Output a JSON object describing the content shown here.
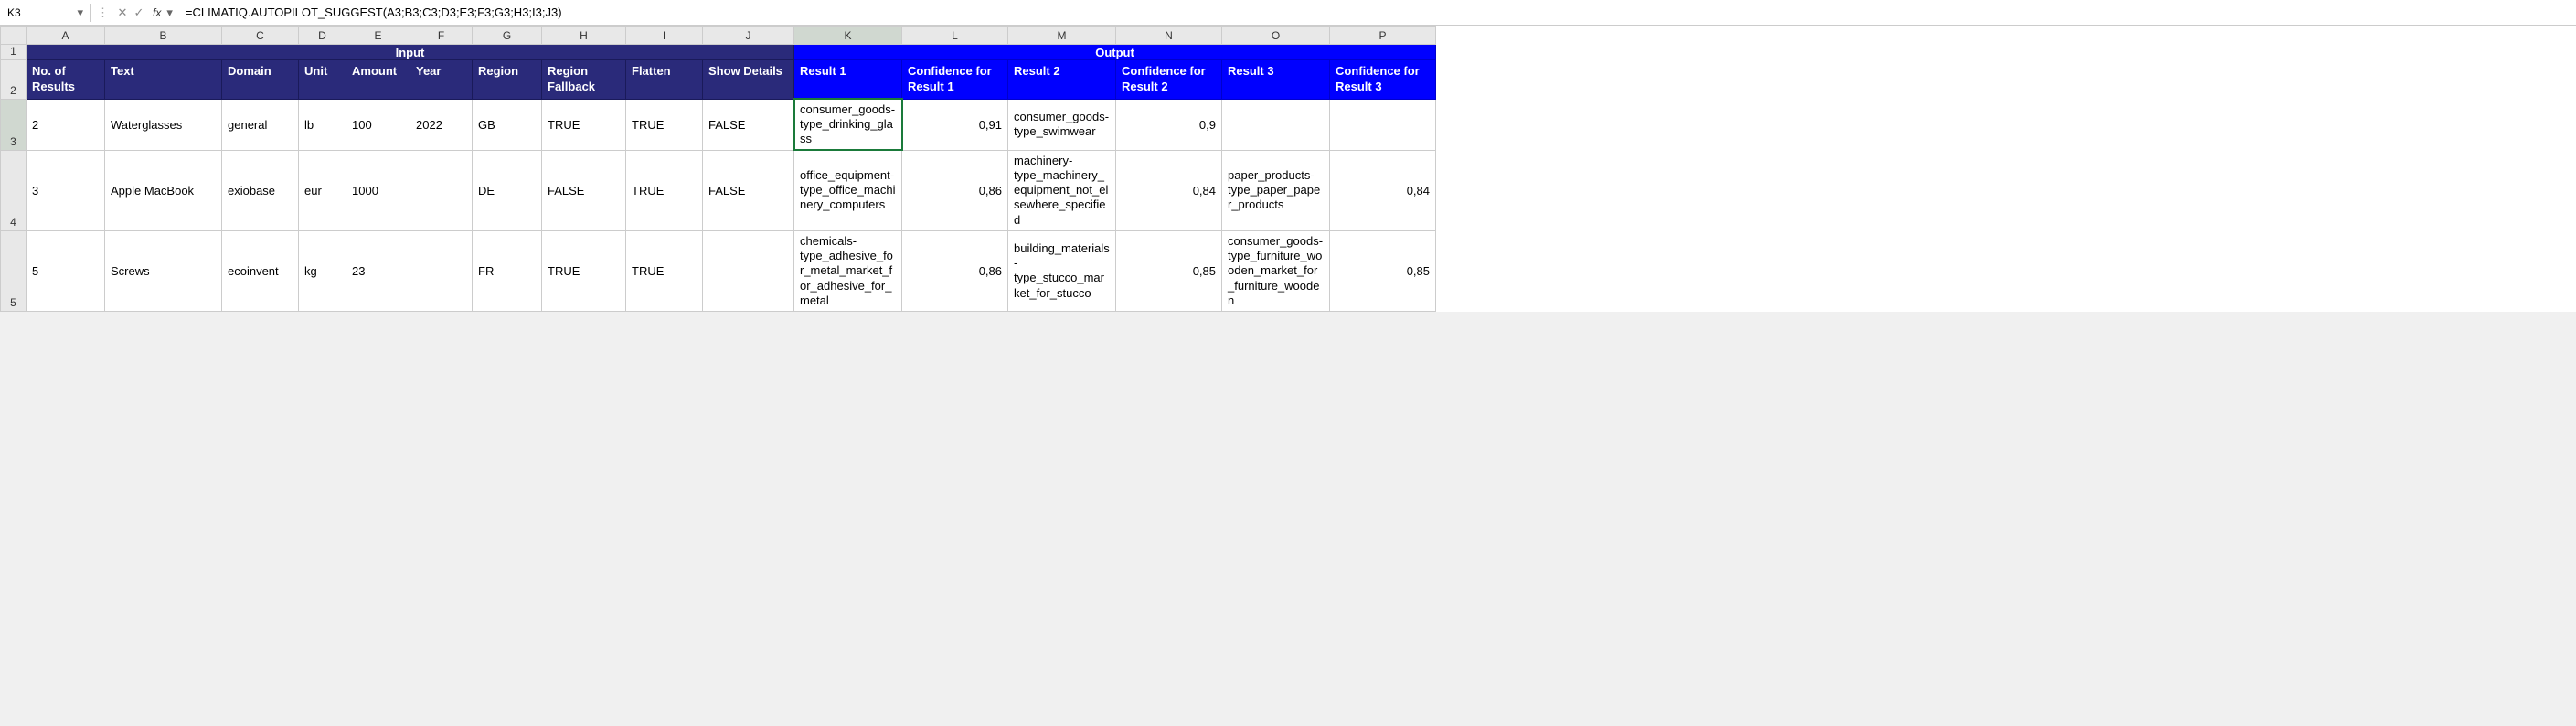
{
  "formula_bar": {
    "cell_ref": "K3",
    "fx_label": "fx",
    "formula": "=CLIMATIQ.AUTOPILOT_SUGGEST(A3;B3;C3;D3;E3;F3;G3;H3;I3;J3)"
  },
  "columns": [
    "A",
    "B",
    "C",
    "D",
    "E",
    "F",
    "G",
    "H",
    "I",
    "J",
    "K",
    "L",
    "M",
    "N",
    "O",
    "P"
  ],
  "active_col": "K",
  "active_row": "3",
  "banners": {
    "input": "Input",
    "output": "Output"
  },
  "headers": {
    "A": "No. of Results",
    "B": "Text",
    "C": "Domain",
    "D": "Unit",
    "E": "Amount",
    "F": "Year",
    "G": "Region",
    "H": "Region Fallback",
    "I": "Flatten",
    "J": "Show Details",
    "K": "Result 1",
    "L": "Confidence for Result 1",
    "M": "Result 2",
    "N": "Confidence for Result 2",
    "O": "Result 3",
    "P": "Confidence for Result 3"
  },
  "rows": {
    "1": "1",
    "2": "2",
    "3": "3",
    "4": "4",
    "5": "5"
  },
  "data": {
    "r3": {
      "A": "2",
      "B": "Waterglasses",
      "C": "general",
      "D": "lb",
      "E": "100",
      "F": "2022",
      "G": "GB",
      "H": "TRUE",
      "I": "TRUE",
      "J": "FALSE",
      "K": "consumer_goods-type_drinking_glass",
      "L": "0,91",
      "M": "consumer_goods-type_swimwear",
      "N": "0,9",
      "O": "",
      "P": ""
    },
    "r4": {
      "A": "3",
      "B": "Apple MacBook",
      "C": "exiobase",
      "D": "eur",
      "E": "1000",
      "F": "",
      "G": "DE",
      "H": "FALSE",
      "I": "TRUE",
      "J": "FALSE",
      "K": "office_equipment-type_office_machinery_computers",
      "L": "0,86",
      "M": "machinery-type_machinery_equipment_not_elsewhere_specified",
      "N": "0,84",
      "O": "paper_products-type_paper_paper_products",
      "P": "0,84"
    },
    "r5": {
      "A": "5",
      "B": "Screws",
      "C": "ecoinvent",
      "D": "kg",
      "E": "23",
      "F": "",
      "G": "FR",
      "H": "TRUE",
      "I": "TRUE",
      "J": "",
      "K": "chemicals-type_adhesive_for_metal_market_for_adhesive_for_metal",
      "L": "0,86",
      "M": "building_materials-type_stucco_market_for_stucco",
      "N": "0,85",
      "O": "consumer_goods-type_furniture_wooden_market_for_furniture_wooden",
      "P": "0,85"
    }
  }
}
